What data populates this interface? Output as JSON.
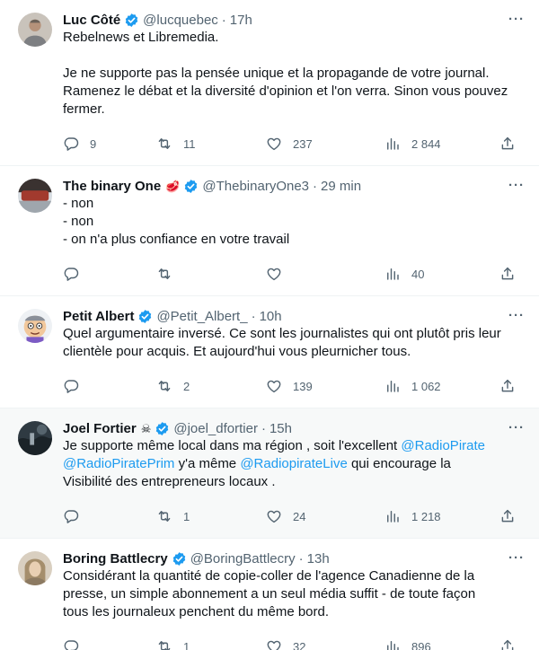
{
  "tweets": [
    {
      "name": "Luc Côté",
      "emoji": "",
      "handle": "@lucquebec",
      "time": "17h",
      "lines": [
        [
          {
            "t": "Rebelnews et Libremedia."
          }
        ],
        [],
        [
          {
            "t": "Je ne supporte pas la pensée unique et la propagande de votre journal."
          }
        ],
        [
          {
            "t": "Ramenez le débat et la diversité d'opinion et l'on verra. Sinon vous pouvez"
          }
        ],
        [
          {
            "t": "fermer."
          }
        ]
      ],
      "replies": "9",
      "retweets": "11",
      "likes": "237",
      "views": "2 844",
      "highlight": false
    },
    {
      "name": "The binary One",
      "emoji": "🥩",
      "handle": "@ThebinaryOne3",
      "time": "29 min",
      "lines": [
        [
          {
            "t": "- non"
          }
        ],
        [
          {
            "t": "- non"
          }
        ],
        [
          {
            "t": "- on n'a plus confiance en votre travail"
          }
        ]
      ],
      "replies": "",
      "retweets": "",
      "likes": "",
      "views": "40",
      "highlight": false
    },
    {
      "name": "Petit Albert",
      "emoji": "",
      "handle": "@Petit_Albert_",
      "time": "10h",
      "lines": [
        [
          {
            "t": "Quel argumentaire inversé. Ce sont les journalistes qui ont plutôt pris leur"
          }
        ],
        [
          {
            "t": "clientèle pour acquis. Et aujourd'hui vous pleurnicher tous."
          }
        ]
      ],
      "replies": "",
      "retweets": "2",
      "likes": "139",
      "views": "1 062",
      "highlight": false
    },
    {
      "name": "Joel Fortier",
      "emoji": "☠",
      "handle": "@joel_dfortier",
      "time": "15h",
      "lines": [
        [
          {
            "t": "Je supporte même local dans ma région , soit l'excellent "
          },
          {
            "t": "@RadioPirate",
            "link": true
          }
        ],
        [
          {
            "t": "@RadioPiratePrim",
            "link": true
          },
          {
            "t": "  y'a même "
          },
          {
            "t": "@RadiopirateLive",
            "link": true
          },
          {
            "t": " qui encourage la"
          }
        ],
        [
          {
            "t": "Visibilité des entrepreneurs locaux ."
          }
        ]
      ],
      "replies": "",
      "retweets": "1",
      "likes": "24",
      "views": "1 218",
      "highlight": true
    },
    {
      "name": "Boring Battlecry",
      "emoji": "",
      "handle": "@BoringBattlecry",
      "time": "13h",
      "lines": [
        [
          {
            "t": "Considérant la quantité de copie-coller de l'agence Canadienne de la"
          }
        ],
        [
          {
            "t": "presse, un simple abonnement a un seul média suffit - de toute façon"
          }
        ],
        [
          {
            "t": "tous les journaleux penchent du même bord."
          }
        ]
      ],
      "replies": "",
      "retweets": "1",
      "likes": "32",
      "views": "896",
      "highlight": false
    }
  ],
  "colors": {
    "accent": "#1d9bf0",
    "text": "#0f1419",
    "muted": "#536471",
    "highlight_bg": "#f7f9f9"
  },
  "icons": [
    "verified-badge-icon",
    "reply-icon",
    "retweet-icon",
    "like-icon",
    "views-icon",
    "share-icon",
    "more-icon"
  ]
}
